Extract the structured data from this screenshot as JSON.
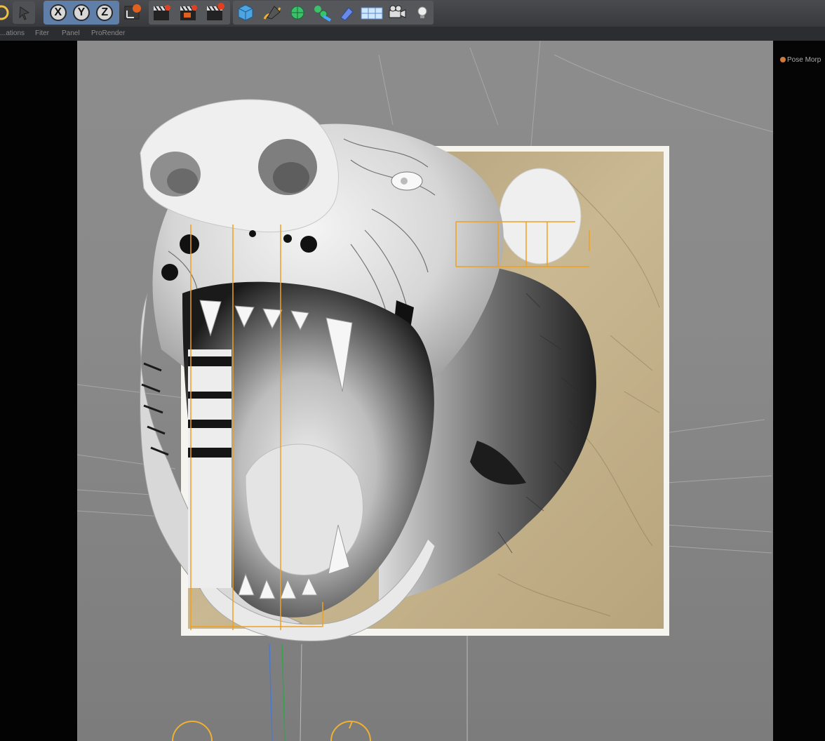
{
  "toolbar": {
    "axis_x": "X",
    "axis_y": "Y",
    "axis_z": "Z",
    "icons": [
      "coordinate-icon",
      "rotate-icon",
      "axis-x-lock",
      "axis-y-lock",
      "axis-z-lock",
      "world-coords-icon",
      "render-view-icon",
      "render-picture-viewer-icon",
      "edit-render-settings-icon",
      "cube-primitive-icon",
      "pen-spline-icon",
      "subdivision-icon",
      "array-clone-icon",
      "deformer-icon",
      "floor-plane-icon",
      "camera-icon",
      "light-icon"
    ]
  },
  "menu": {
    "items": [
      "...ations",
      "Fiter",
      "Panel",
      "ProRender"
    ]
  },
  "object_manager": {
    "tag_label": "Pose Morp"
  },
  "colors": {
    "toolbar_bg": "#3f4043",
    "axis_group": "#5f7fa8",
    "viewport_bg": "#8a8a8a",
    "selection_orange": "#f0a020",
    "backdrop_beige": "#bca97f"
  }
}
